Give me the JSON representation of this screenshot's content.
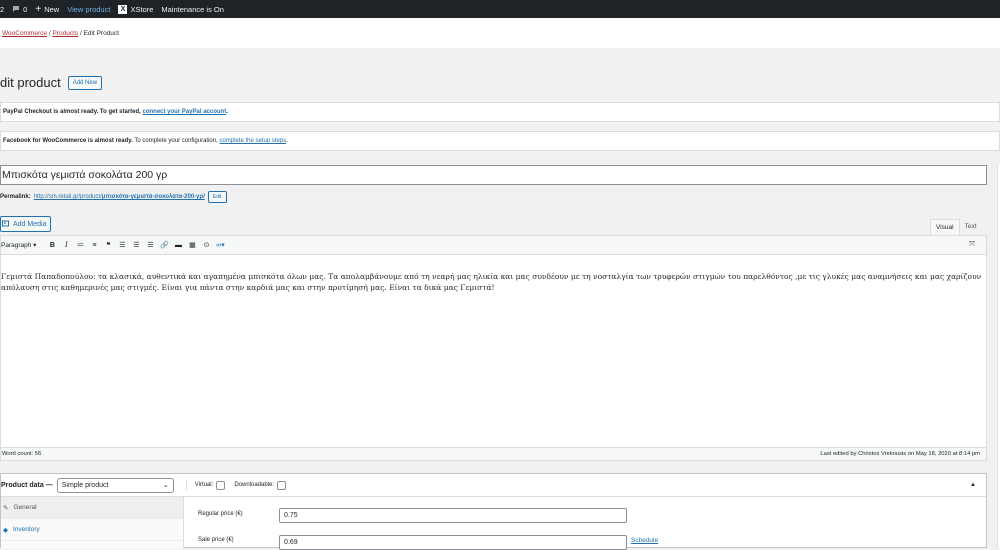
{
  "adminbar": {
    "count_a": "2",
    "comments_count": "0",
    "new_label": "New",
    "view_product": "View product",
    "xstore_icon_letter": "X",
    "xstore": "XStore",
    "maintenance": "Maintenance is On"
  },
  "breadcrumb": {
    "woocommerce": "WooCommerce",
    "sep1": "/",
    "products": "Products",
    "sep2": "/",
    "current": "Edit Product"
  },
  "page": {
    "title": "dit product",
    "add_new": "Add New"
  },
  "notices": {
    "paypal_bold": "PayPal Checkout is almost ready. To get started,",
    "paypal_link": "connect your PayPal account",
    "paypal_end": ".",
    "facebook_bold": "Facebook for WooCommerce is almost ready.",
    "facebook_text": "To complete your configuration,",
    "facebook_link": "complete the setup steps",
    "facebook_end": "."
  },
  "product": {
    "title": "Μπισκότα γεμιστά σοκολάτα 200 γρ",
    "permalink_label": "Permalink:",
    "permalink_base": "http://sm.retail.gr/product/",
    "permalink_slug": "μπισκότα-γεμιστά-σοκολάτα-200-γρ/",
    "permalink_edit": "Edit"
  },
  "editor": {
    "add_media": "Add Media",
    "tab_visual": "Visual",
    "tab_text": "Text",
    "format": "Paragraph",
    "content": "Γεμιστά Παπαδοπούλου: τα κλασικά, αυθεντικά και αγαπημένα μπισκότα όλων μας. Τα απολαμβάνουμε από τη νεαρή μας ηλικία και μας συνδέουν με τη νοσταλγία των τρυφερών στιγμών του παρελθόντος ,με τις γλυκές μας αναμνήσεις και μας χαρίζουν απόλαυση στις καθημερινές μας στιγμές. Είναι για πάντα στην καρδιά μας και στην προτίμησή μας. Είναι τα δικά μας Γεμιστά!",
    "word_count": "Word count: 56",
    "last_edited": "Last edited by Christos Vrekousis on May 18, 2020 at 8:14 pm"
  },
  "product_data": {
    "label": "Product data —",
    "type": "Simple product",
    "virtual": "Virtual:",
    "downloadable": "Downloadable:",
    "tabs": [
      "General",
      "Inventory"
    ],
    "regular_price_label": "Regular price (€)",
    "regular_price": "0.75",
    "sale_price_label": "Sale price (€)",
    "sale_price": "0.69",
    "schedule": "Schedule"
  },
  "colors": {
    "link": "#2271b1",
    "adminbar": "#1d2327",
    "breadcrumb_link": "#b32d2e"
  }
}
